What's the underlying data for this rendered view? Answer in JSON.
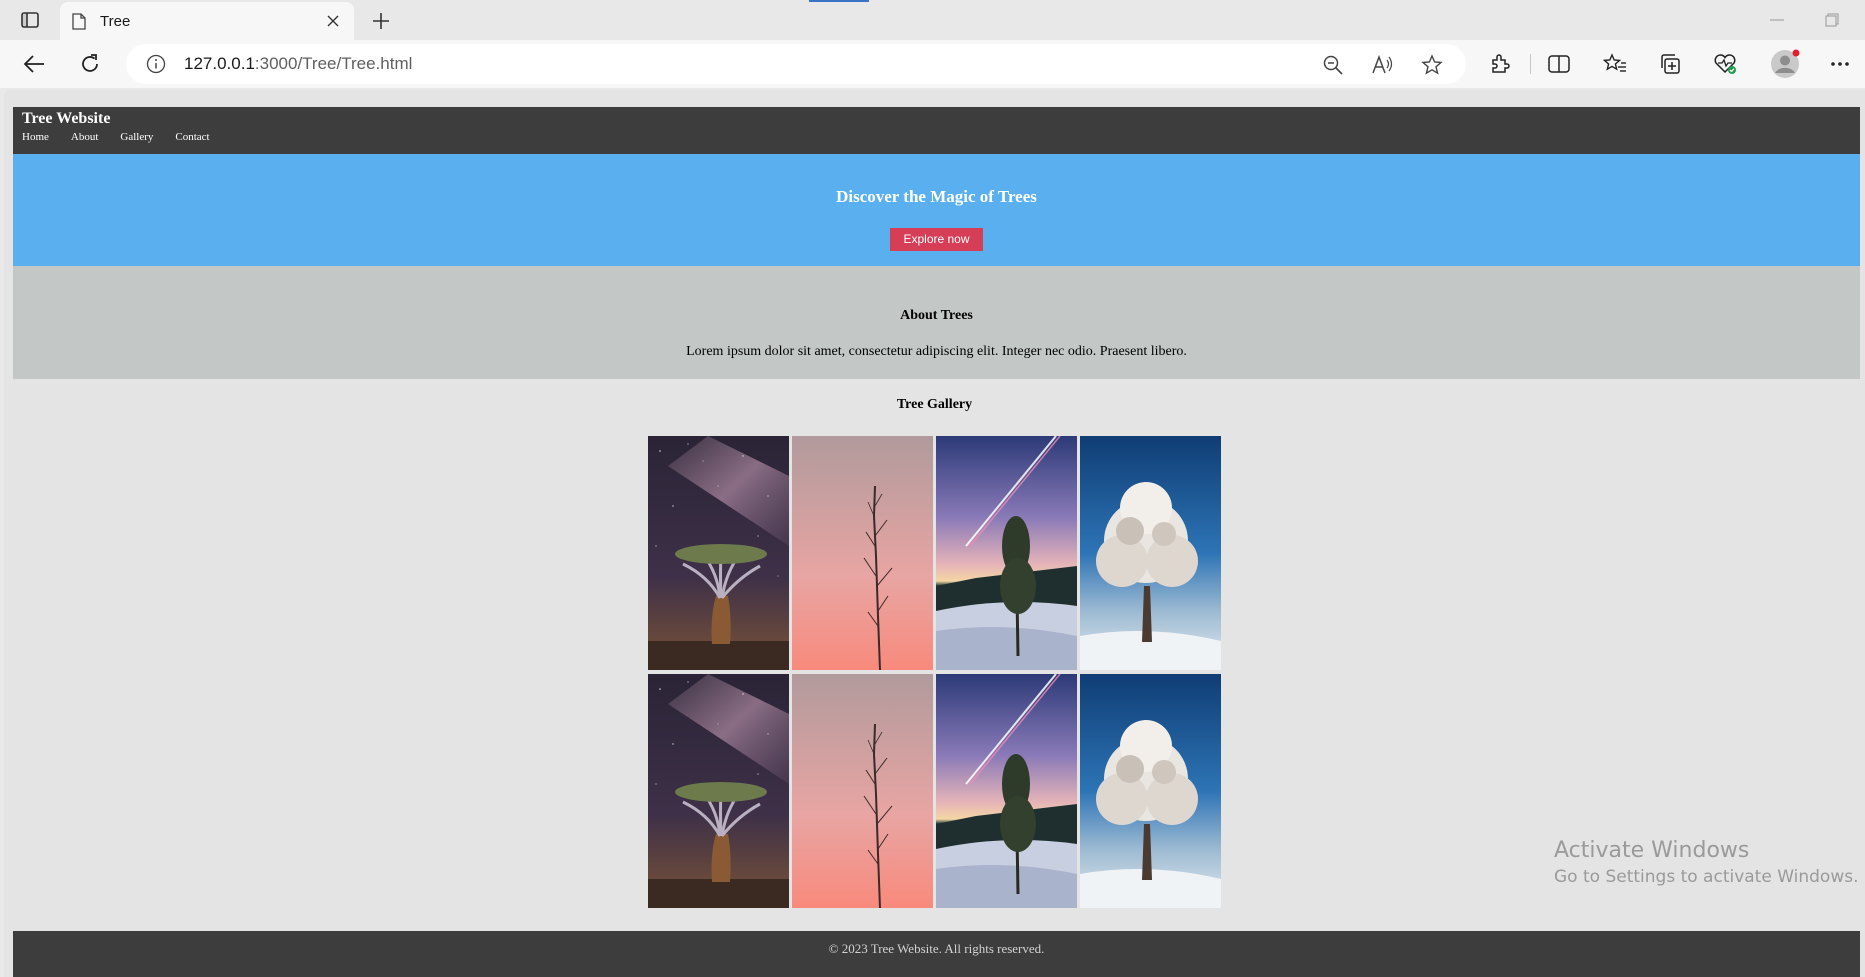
{
  "browser": {
    "tab_title": "Tree",
    "url_host": "127.0.0.1",
    "url_rest": ":3000/Tree/Tree.html",
    "icons": [
      "sidebar-icon",
      "page-icon",
      "close-icon",
      "plus-icon",
      "back-icon",
      "refresh-icon",
      "info-icon",
      "zoom-out-icon",
      "read-aloud-icon",
      "favorite-star-icon",
      "extensions-icon",
      "split-screen-icon",
      "favorites-icon",
      "collections-icon",
      "browser-essentials-icon",
      "profile-icon",
      "more-icon"
    ]
  },
  "site": {
    "title": "Tree Website",
    "nav": [
      "Home",
      "About",
      "Gallery",
      "Contact"
    ]
  },
  "hero": {
    "title": "Discover the Magic of Trees",
    "button": "Explore now"
  },
  "about": {
    "title": "About Trees",
    "text": "Lorem ipsum dolor sit amet, consectetur adipiscing elit. Integer nec odio. Praesent libero."
  },
  "gallery": {
    "title": "Tree Gallery",
    "images": [
      "quiver-tree-milky-way",
      "bare-tree-pink-sky",
      "snowy-tree-meteor-trail",
      "frosted-tree-blue-sky",
      "quiver-tree-milky-way",
      "bare-tree-pink-sky",
      "snowy-tree-meteor-trail",
      "frosted-tree-blue-sky"
    ]
  },
  "footer": {
    "text": "© 2023 Tree Website. All rights reserved."
  },
  "watermark": {
    "line1": "Activate Windows",
    "line2": "Go to Settings to activate Windows."
  },
  "colors": {
    "header_bg": "#3d3d3d",
    "hero_bg": "#5aafef",
    "button_bg": "#d63d56",
    "about_bg": "#c3c8c6",
    "page_bg": "#e4e4e4"
  }
}
